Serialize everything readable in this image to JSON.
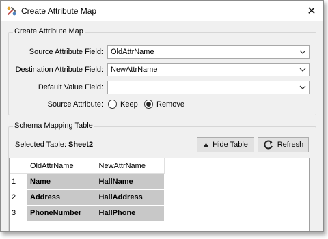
{
  "window": {
    "title": "Create Attribute Map",
    "close_symbol": "✕"
  },
  "map_group": {
    "legend": "Create Attribute Map",
    "source_label": "Source Attribute Field:",
    "source_value": "OldAttrName",
    "dest_label": "Destination Attribute Field:",
    "dest_value": "NewAttrName",
    "default_label": "Default Value Field:",
    "default_value": "",
    "source_attr_label": "Source Attribute:",
    "radio_keep": "Keep",
    "radio_remove": "Remove",
    "selected_radio": "Remove"
  },
  "schema_group": {
    "legend": "Schema Mapping Table",
    "selected_table_label": "Selected Table:",
    "selected_table_value": "Sheet2",
    "hide_table_label": "Hide Table",
    "refresh_label": "Refresh"
  },
  "table": {
    "columns": [
      "OldAttrName",
      "NewAttrName"
    ],
    "rows": [
      {
        "num": "1",
        "old": "Name",
        "new": "HallName"
      },
      {
        "num": "2",
        "old": "Address",
        "new": "HallAddress"
      },
      {
        "num": "3",
        "old": "PhoneNumber",
        "new": "HallPhone"
      }
    ]
  },
  "icons": {
    "app": "attribute-map-icon",
    "close": "close-icon",
    "dropdown": "chevron-down-icon",
    "hide": "triangle-up-icon",
    "refresh": "refresh-icon"
  }
}
